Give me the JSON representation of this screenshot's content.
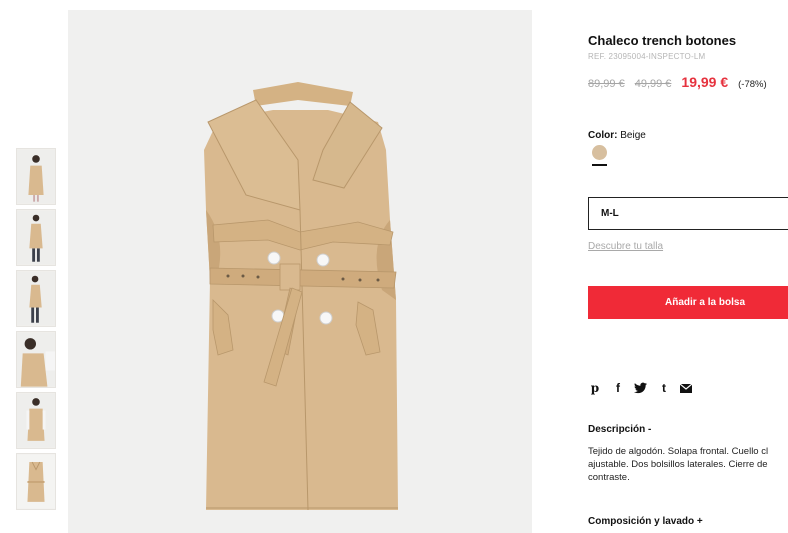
{
  "product": {
    "title": "Chaleco trench botones",
    "ref": "REF. 23095004-INSPECTO-LM",
    "old_price_1": "89,99 €",
    "old_price_2": "49,99 €",
    "price": "19,99 €",
    "discount": "(-78%)"
  },
  "color": {
    "label": "Color:",
    "value": "Beige",
    "swatch_hex": "#d7bf9f"
  },
  "size": {
    "selected": "M-L",
    "guide_link": "Descubre tu talla"
  },
  "cart": {
    "add_label": "Añadir a la bolsa",
    "button_color": "#f02a37"
  },
  "share": {
    "icons": [
      "pinterest-icon",
      "facebook-icon",
      "twitter-icon",
      "tumblr-icon",
      "email-icon"
    ],
    "pinterest": "p",
    "facebook": "f",
    "tumblr": "t"
  },
  "description": {
    "heading": "Descripción -",
    "line1": "Tejido de algodón. Solapa frontal. Cuello cl",
    "line2": "ajustable. Dos bolsillos laterales. Cierre de",
    "line3": "contraste."
  },
  "composition": {
    "heading": "Composición y lavado +"
  },
  "gallery": {
    "thumbnail_count": 6,
    "main_image": "beige-sleeveless-trench-vest"
  },
  "colors": {
    "coat": "#d9b98f",
    "coat_shadow": "#c9a679",
    "price_red": "#e6323e"
  }
}
